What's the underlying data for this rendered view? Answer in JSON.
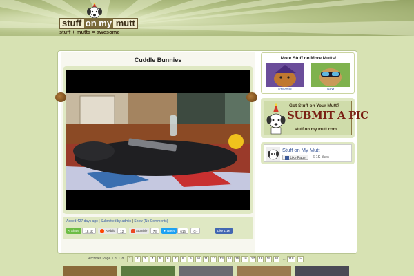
{
  "site": {
    "logo_word_1": "stuff",
    "logo_word_2": "on my",
    "logo_word_3": "mutt",
    "tagline": "stuff + mutts = awesome"
  },
  "post": {
    "title": "Cuddle Bunnies",
    "meta_added": "Added 427 days ago",
    "meta_sep_1": "|",
    "meta_submitted": "Submitted by admin",
    "meta_sep_2": "|",
    "meta_show": "Show (No Comments)"
  },
  "share": {
    "share_label": "Share",
    "share_count": "18.1K",
    "reddit_label": "Reddit",
    "reddit_count": "12",
    "stumble_label": "Stumble",
    "stumble_count": "73",
    "tweet_label": "Tweet",
    "tweet_count": "616",
    "gplus_label": "G+",
    "fb_like_label": "Like 1.1K"
  },
  "sidebar": {
    "more_title": "More Stuff on More Mutts!",
    "previous_label": "Previous",
    "next_label": "Next",
    "submit_question": "Got Stuff on Your Mutt?",
    "submit_big": "SUBMIT A PIC",
    "submit_brand": "stuff on my mutt.com",
    "fb_page_name": "Stuff on My Mutt",
    "fb_like_page": "Like Page",
    "fb_likes": "6.1K likes"
  },
  "pagination": {
    "label": "Archives Page 1 of 118",
    "pages": [
      "1",
      "2",
      "3",
      "4",
      "5",
      "6",
      "7",
      "8",
      "9",
      "10",
      "11",
      "12",
      "13",
      "14",
      "15",
      "16",
      "17",
      "18",
      "19",
      "20"
    ],
    "ellipsis": "...",
    "last_page": "118",
    "next": "»"
  },
  "colors": {
    "page_bg": "#d7e2b3",
    "panel_green": "#dfe8c3",
    "link_blue": "#3a5da8",
    "share_green": "#6cbd45",
    "reddit_orange": "#ff4500",
    "stumble_orange": "#eb4924",
    "twitter_blue": "#1da1f2",
    "facebook_blue": "#3b5998",
    "submit_red": "#7a2014"
  }
}
